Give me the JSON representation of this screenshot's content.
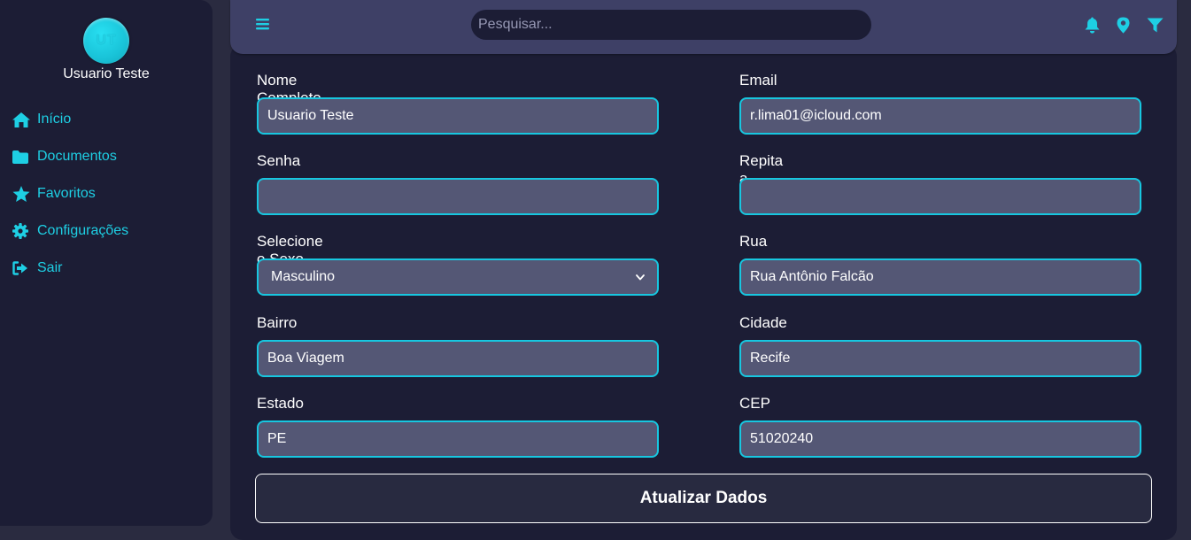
{
  "sidebar": {
    "avatar_initials": "UT",
    "username": "Usuario Teste",
    "items": [
      {
        "label": "Início",
        "icon": "home-icon"
      },
      {
        "label": "Documentos",
        "icon": "folder-icon"
      },
      {
        "label": "Favoritos",
        "icon": "star-icon"
      },
      {
        "label": "Configurações",
        "icon": "gear-icon"
      },
      {
        "label": "Sair",
        "icon": "sign-out-icon"
      }
    ]
  },
  "header": {
    "menu_icon": "menu-icon",
    "search_placeholder": "Pesquisar...",
    "icons": [
      "bell-icon",
      "location-pin-icon",
      "filter-icon"
    ]
  },
  "form": {
    "full_name": {
      "label": "Nome Completo",
      "value": "Usuario Teste"
    },
    "email": {
      "label": "Email",
      "value": "r.lima01@icloud.com"
    },
    "password": {
      "label": "Senha",
      "value": ""
    },
    "repeat_password": {
      "label": "Repita a Senha",
      "value": ""
    },
    "sex": {
      "label": "Selecione o Sexo",
      "value": "Masculino"
    },
    "street": {
      "label": "Rua",
      "value": "Rua Antônio Falcão"
    },
    "neighborhood": {
      "label": "Bairro",
      "value": "Boa Viagem"
    },
    "city": {
      "label": "Cidade",
      "value": "Recife"
    },
    "state": {
      "label": "Estado",
      "value": "PE"
    },
    "zip": {
      "label": "CEP",
      "value": "51020240"
    },
    "submit_label": "Atualizar Dados"
  },
  "colors": {
    "accent": "#17c7e0",
    "sidebar_bg": "#1c1d35",
    "topbar_bg": "#3e4066",
    "input_bg": "#545775"
  }
}
